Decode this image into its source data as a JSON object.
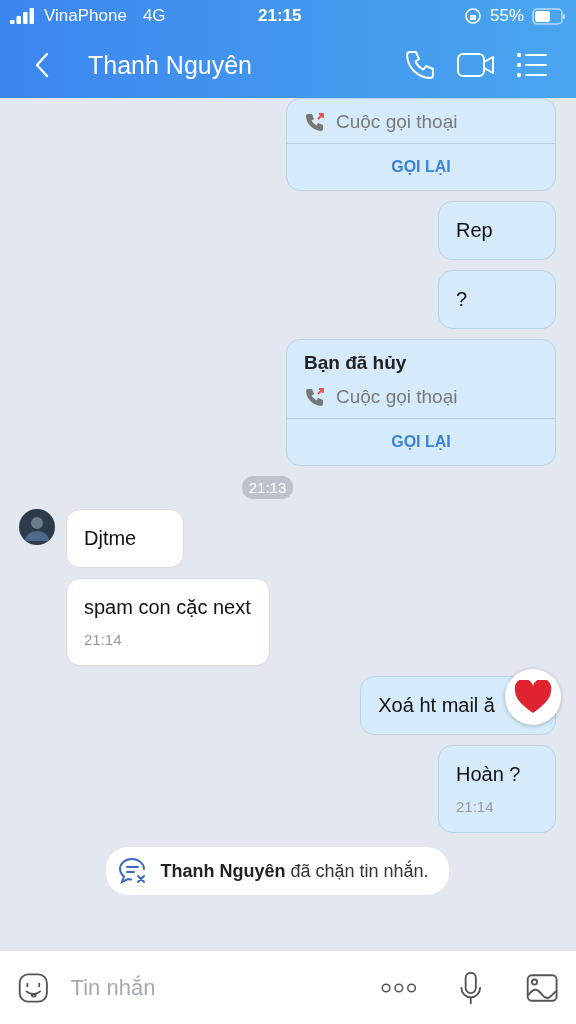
{
  "status_bar": {
    "carrier": "VinaPhone",
    "network": "4G",
    "time": "21:15",
    "battery": "55%"
  },
  "header": {
    "title": "Thanh Nguyên"
  },
  "messages": [
    {
      "kind": "call",
      "outgoing": true,
      "detail": "Cuộc gọi thoại",
      "action": "GỌI LẠI"
    },
    {
      "kind": "text",
      "outgoing": true,
      "text": "Rep"
    },
    {
      "kind": "text",
      "outgoing": true,
      "text": "?"
    },
    {
      "kind": "call",
      "outgoing": true,
      "title": "Bạn đã hủy",
      "detail": "Cuộc gọi thoại",
      "action": "GỌI LẠI"
    },
    {
      "kind": "time",
      "text": "21:13"
    },
    {
      "kind": "text",
      "outgoing": false,
      "text": "Djtme",
      "avatar": true
    },
    {
      "kind": "text",
      "outgoing": false,
      "text": "spam con cặc next",
      "time": "21:14"
    },
    {
      "kind": "text",
      "outgoing": true,
      "text": "Xoá ht mail ă",
      "reacted": true
    },
    {
      "kind": "text",
      "outgoing": true,
      "text": "Hoàn ?",
      "time": "21:14"
    },
    {
      "kind": "notice",
      "text": "**Thanh Nguyên** đã chặn tin nhắn."
    }
  ],
  "composer": {
    "placeholder": "Tin nhắn"
  }
}
